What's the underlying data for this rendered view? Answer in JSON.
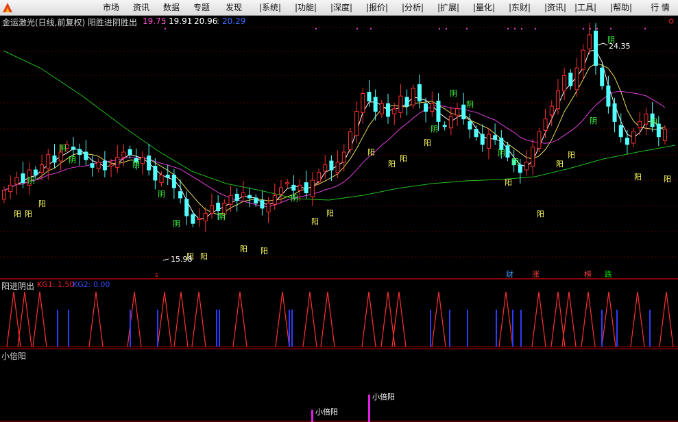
{
  "menubar": {
    "items": [
      "市场",
      "资讯",
      "数据",
      "专题",
      "发现",
      "|系统|",
      "|功能|",
      "|深度|",
      "|报价|",
      "|分析|",
      "|扩展|",
      "|量化|",
      "|东财|",
      "|资讯|",
      "|工具|",
      "|帮助|",
      "行 情"
    ]
  },
  "header": {
    "title": "金运激光(日线,前复权) 阳胜进阴胜出",
    "ma_values": [
      "19.75",
      "19.91",
      "20.96",
      "20.29"
    ],
    "ma_colors": [
      "#ff4fd0",
      "#ffffff",
      "#ffffff",
      "#3a6bff"
    ],
    "separators": [
      ": ",
      ": ",
      ": "
    ]
  },
  "main_chart": {
    "high_label": "24.35",
    "low_label": "15.98",
    "signal_label_bull": "阳",
    "signal_label_bear": "阴",
    "events": [
      "财",
      "涨",
      "榜",
      "跌"
    ],
    "event_colors": [
      "#4aa0ff",
      "#ff4040",
      "#ff4040",
      "#00e000"
    ],
    "small_marker": "s"
  },
  "sub_chart_1": {
    "title": "阳进阴出",
    "kg1_label": "KG1: 1.50",
    "kg2_label": "KG2: 0.00",
    "kg1_color": "#ff2020",
    "kg2_color": "#3a50ff"
  },
  "sub_chart_2": {
    "title": "小倍阳",
    "signals": [
      "小倍阳",
      "小倍阳"
    ]
  },
  "colors": {
    "up_candle": "#ff3030",
    "down_candle": "#54ffff",
    "ma_fast": "#ffffff",
    "ma_mid": "#e8e060",
    "ma_slow": "#e040e0",
    "ma_long": "#20c020",
    "grid": "#5a0000",
    "border": "#b00000"
  }
}
